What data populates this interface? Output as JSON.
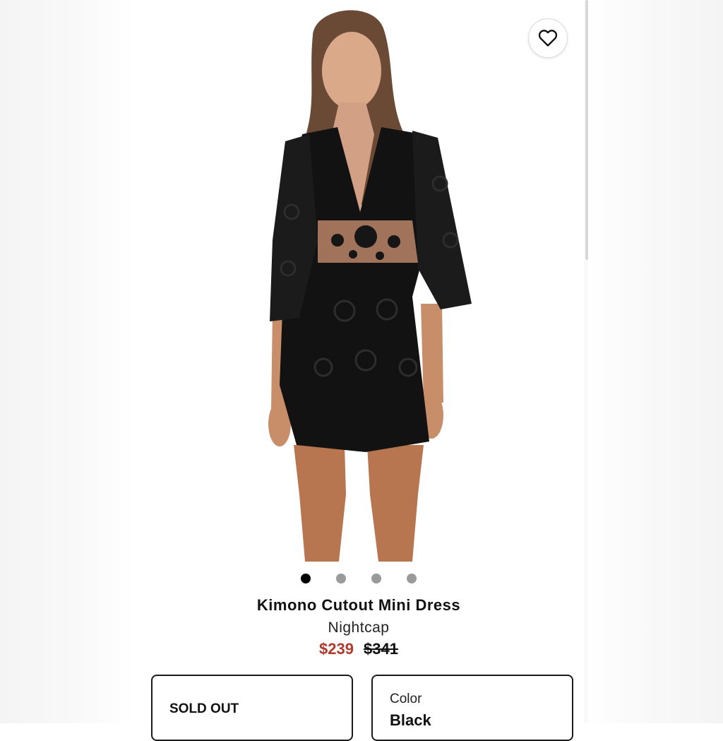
{
  "product": {
    "title": "Kimono Cutout Mini Dress",
    "brand": "Nightcap",
    "sale_price": "$239",
    "original_price": "$341",
    "colors": {
      "sale": "#b03a2e",
      "dress": "#111111"
    }
  },
  "gallery": {
    "image_count": 4,
    "active_index": 0
  },
  "actions": {
    "favorite_icon": "heart-outline-icon"
  },
  "size_box": {
    "label": "SOLD OUT"
  },
  "color_box": {
    "label": "Color",
    "value": "Black"
  }
}
